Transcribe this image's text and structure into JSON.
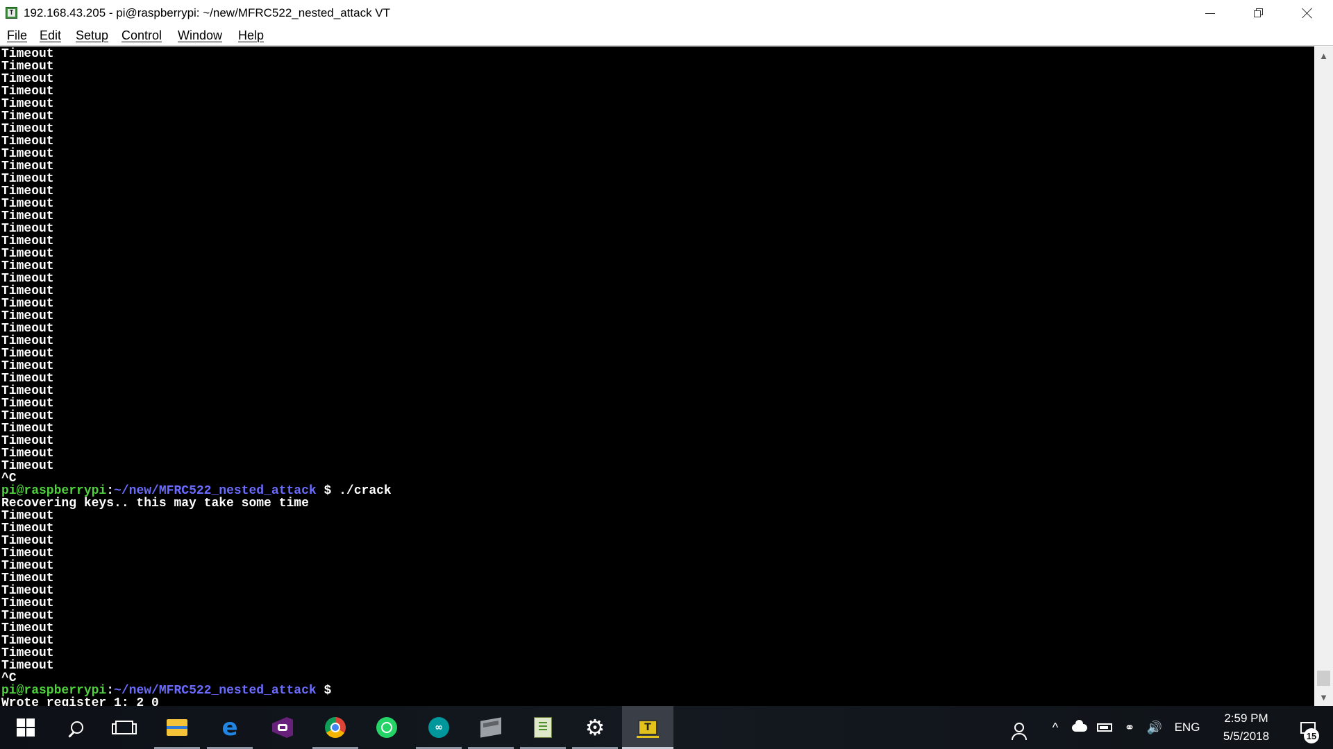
{
  "window": {
    "title": "192.168.43.205 - pi@raspberrypi: ~/new/MFRC522_nested_attack VT",
    "app_icon_letter": "T",
    "controls": {
      "minimize_icon": "minimize-icon",
      "maximize_icon": "restore-icon",
      "close_icon": "close-icon"
    }
  },
  "menubar": {
    "items": [
      {
        "label": "File"
      },
      {
        "label": "Edit"
      },
      {
        "label": "Setup"
      },
      {
        "label": "Control"
      },
      {
        "label": "Window"
      },
      {
        "label": "Help"
      }
    ]
  },
  "terminal": {
    "colors": {
      "background": "#000000",
      "text": "#ffffff",
      "prompt_user": "#4ed13d",
      "prompt_path": "#6b6bff"
    },
    "lines": [
      {
        "text": "Timeout"
      },
      {
        "text": "Timeout"
      },
      {
        "text": "Timeout"
      },
      {
        "text": "Timeout"
      },
      {
        "text": "Timeout"
      },
      {
        "text": "Timeout"
      },
      {
        "text": "Timeout"
      },
      {
        "text": "Timeout"
      },
      {
        "text": "Timeout"
      },
      {
        "text": "Timeout"
      },
      {
        "text": "Timeout"
      },
      {
        "text": "Timeout"
      },
      {
        "text": "Timeout"
      },
      {
        "text": "Timeout"
      },
      {
        "text": "Timeout"
      },
      {
        "text": "Timeout"
      },
      {
        "text": "Timeout"
      },
      {
        "text": "Timeout"
      },
      {
        "text": "Timeout"
      },
      {
        "text": "Timeout"
      },
      {
        "text": "Timeout"
      },
      {
        "text": "Timeout"
      },
      {
        "text": "Timeout"
      },
      {
        "text": "Timeout"
      },
      {
        "text": "Timeout"
      },
      {
        "text": "Timeout"
      },
      {
        "text": "Timeout"
      },
      {
        "text": "Timeout"
      },
      {
        "text": "Timeout"
      },
      {
        "text": "Timeout"
      },
      {
        "text": "Timeout"
      },
      {
        "text": "Timeout"
      },
      {
        "text": "Timeout"
      },
      {
        "text": "Timeout"
      },
      {
        "text": "^C"
      },
      {
        "prompt": {
          "user": "pi@raspberrypi",
          "sep": ":",
          "path": "~/new/MFRC522_nested_attack",
          "symbol": " $ ",
          "cmd": "./crack"
        }
      },
      {
        "text": "Recovering keys.. this may take some time"
      },
      {
        "text": "Timeout"
      },
      {
        "text": "Timeout"
      },
      {
        "text": "Timeout"
      },
      {
        "text": "Timeout"
      },
      {
        "text": "Timeout"
      },
      {
        "text": "Timeout"
      },
      {
        "text": "Timeout"
      },
      {
        "text": "Timeout"
      },
      {
        "text": "Timeout"
      },
      {
        "text": "Timeout"
      },
      {
        "text": "Timeout"
      },
      {
        "text": "Timeout"
      },
      {
        "text": "Timeout"
      },
      {
        "text": "^C"
      },
      {
        "prompt": {
          "user": "pi@raspberrypi",
          "sep": ":",
          "path": "~/new/MFRC522_nested_attack",
          "symbol": " $",
          "cmd": ""
        }
      },
      {
        "text": "Wrote register 1: 2 0"
      }
    ]
  },
  "scrollbar": {
    "up_icon": "scroll-up-arrow",
    "down_icon": "scroll-down-arrow"
  },
  "taskbar": {
    "apps": [
      {
        "name": "start-button",
        "icon": "windows-icon",
        "running": false
      },
      {
        "name": "search-button",
        "icon": "search-icon",
        "running": false
      },
      {
        "name": "task-view-button",
        "icon": "task-view-icon",
        "running": false
      },
      {
        "name": "file-explorer",
        "icon": "folder-icon",
        "running": true
      },
      {
        "name": "edge-browser",
        "icon": "edge-icon",
        "running": true
      },
      {
        "name": "visual-studio",
        "icon": "visual-studio-icon",
        "running": false
      },
      {
        "name": "chrome-browser",
        "icon": "chrome-icon",
        "running": true
      },
      {
        "name": "whatsapp",
        "icon": "whatsapp-icon",
        "running": false
      },
      {
        "name": "arduino-ide",
        "icon": "arduino-icon",
        "running": true
      },
      {
        "name": "virtual-machine",
        "icon": "box-icon",
        "running": true
      },
      {
        "name": "notepad-plus",
        "icon": "notepad-icon",
        "running": true
      },
      {
        "name": "settings",
        "icon": "gear-icon",
        "running": true
      },
      {
        "name": "teraterm",
        "icon": "teraterm-icon",
        "running": true,
        "active": true
      }
    ],
    "tray": {
      "chevron": "^",
      "language": "ENG",
      "time": "2:59 PM",
      "date": "5/5/2018",
      "notification_count": "15"
    }
  }
}
